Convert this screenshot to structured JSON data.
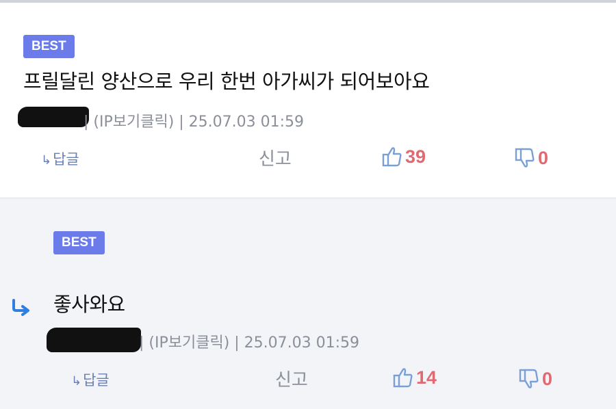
{
  "colors": {
    "badge_bg": "#6b7bea",
    "vote_count": "#e06a72",
    "icon_blue": "#7a9fd6",
    "reply_arrow_blue": "#2f7fe0",
    "meta_gray": "#8a8f99"
  },
  "comments": [
    {
      "badge": "BEST",
      "text": "프릴달린 양산으로 우리 한번 아가씨가 되어보아요",
      "meta": "| (IP보기클릭) | 25.07.03 01:59",
      "reply_label": "답글",
      "report_label": "신고",
      "likes": "39",
      "dislikes": "0",
      "icons": [
        "reply-arrow-icon",
        "thumbs-up-icon",
        "thumbs-down-icon"
      ]
    },
    {
      "badge": "BEST",
      "text": "좋사와요",
      "meta": "| (IP보기클릭) | 25.07.03 01:59",
      "reply_label": "답글",
      "report_label": "신고",
      "likes": "14",
      "dislikes": "0",
      "icons": [
        "nested-reply-arrow-icon",
        "reply-arrow-icon",
        "thumbs-up-icon",
        "thumbs-down-icon"
      ]
    }
  ]
}
